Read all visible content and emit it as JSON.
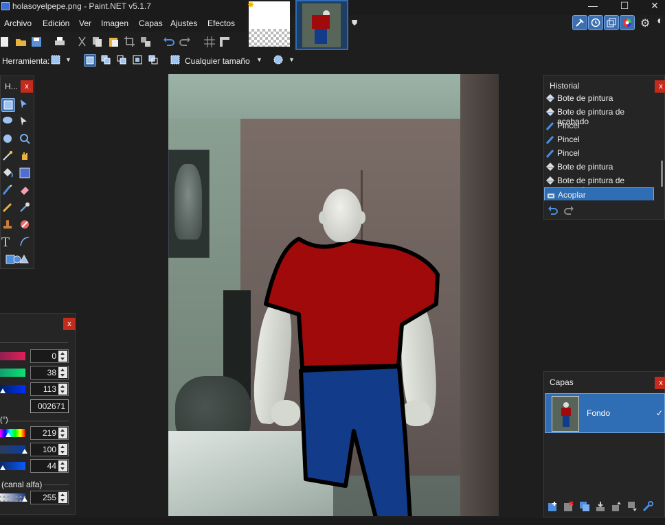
{
  "window": {
    "title": "holasoyelpepe.png - Paint.NET v5.1.7",
    "controls": {
      "minimize": "—",
      "maximize": "☐",
      "close": "✕"
    }
  },
  "menu": [
    "Archivo",
    "Edición",
    "Ver",
    "Imagen",
    "Capas",
    "Ajustes",
    "Efectos"
  ],
  "toolbar": {
    "tool_label": "Herramienta:",
    "size_label": "Cualquier tamaño"
  },
  "tools_panel": {
    "title": "H...",
    "close": "x"
  },
  "history_panel": {
    "title": "Historial",
    "close": "x",
    "items": [
      {
        "label": "Bote de pintura",
        "icon": "paint-bucket-icon"
      },
      {
        "label": "Bote de pintura de acabado",
        "icon": "paint-bucket-icon"
      },
      {
        "label": "Pincel",
        "icon": "paintbrush-icon"
      },
      {
        "label": "Pincel",
        "icon": "paintbrush-icon"
      },
      {
        "label": "Pincel",
        "icon": "paintbrush-icon"
      },
      {
        "label": "Bote de pintura",
        "icon": "paint-bucket-icon"
      },
      {
        "label": "Bote de pintura de acabado",
        "icon": "paint-bucket-icon"
      },
      {
        "label": "Acoplar",
        "icon": "flatten-icon",
        "selected": true
      }
    ]
  },
  "colors_panel": {
    "close": "x",
    "red": "0",
    "green": "38",
    "blue": "113",
    "hex": "002671",
    "hsv_label": "(°)",
    "hue": "219",
    "saturation": "100",
    "value": "44",
    "alpha_label": "(canal alfa)",
    "alpha": "255"
  },
  "layers_panel": {
    "title": "Capas",
    "close": "x",
    "layers": [
      {
        "name": "Fondo",
        "visible_check": "✓"
      }
    ]
  },
  "colors": {
    "accent": "#2f6db4",
    "shirt": "#a00a0a",
    "pants": "#123c8a",
    "close_red": "#c42b1c"
  }
}
